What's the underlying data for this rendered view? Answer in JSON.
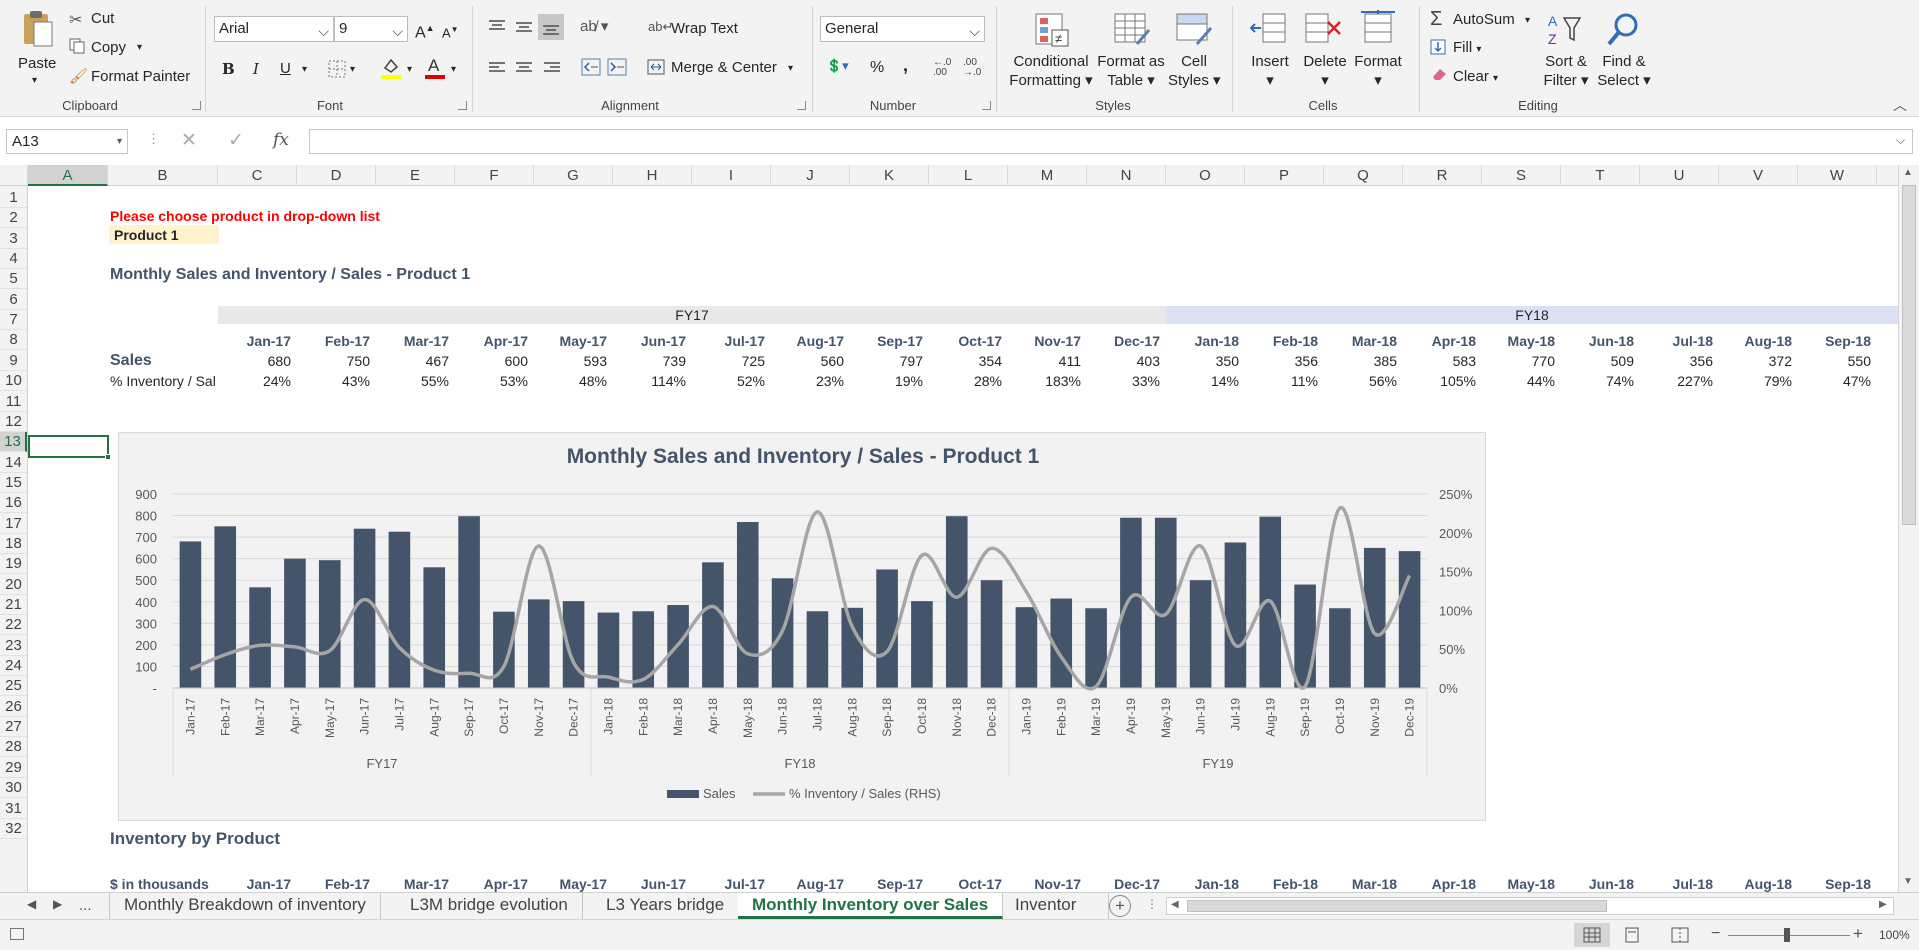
{
  "ribbon": {
    "clipboard": {
      "paste": "Paste",
      "cut": "Cut",
      "copy": "Copy",
      "format_painter": "Format Painter",
      "label": "Clipboard"
    },
    "font": {
      "name": "Arial",
      "size": "9",
      "label": "Font",
      "bold": "B",
      "italic": "I",
      "underline": "U"
    },
    "alignment": {
      "wrap_text": "Wrap Text",
      "merge_center": "Merge & Center",
      "label": "Alignment"
    },
    "number": {
      "format": "General",
      "percent": "%",
      "comma": ",",
      "label": "Number"
    },
    "styles": {
      "conditional": "Conditional",
      "conditional2": "Formatting",
      "format_as": "Format as",
      "format_as2": "Table",
      "cell": "Cell",
      "cell2": "Styles",
      "label": "Styles"
    },
    "cells": {
      "insert": "Insert",
      "delete": "Delete",
      "format": "Format",
      "label": "Cells"
    },
    "editing": {
      "autosum": "AutoSum",
      "fill": "Fill",
      "clear": "Clear",
      "sort": "Sort &",
      "sort2": "Filter",
      "find": "Find &",
      "find2": "Select",
      "label": "Editing"
    }
  },
  "formula_bar": {
    "name_box": "A13",
    "fx": "fx",
    "formula": ""
  },
  "columns": [
    "A",
    "B",
    "C",
    "D",
    "E",
    "F",
    "G",
    "H",
    "I",
    "J",
    "K",
    "L",
    "M",
    "N",
    "O",
    "P",
    "Q",
    "R",
    "S",
    "T",
    "U",
    "V",
    "W"
  ],
  "rows": [
    "1",
    "2",
    "3",
    "4",
    "5",
    "6",
    "7",
    "8",
    "9",
    "10",
    "11",
    "12",
    "13",
    "14",
    "15",
    "16",
    "17",
    "18",
    "19",
    "20",
    "21",
    "22",
    "23",
    "24",
    "25",
    "26",
    "27",
    "28",
    "29",
    "30",
    "31",
    "32"
  ],
  "sheet": {
    "instruction": "Please choose product in drop-down list",
    "product": "Product 1",
    "section_title": "Monthly Sales and Inventory / Sales -  Product 1",
    "fy17": "FY17",
    "fy18": "FY18",
    "months": [
      "Jan-17",
      "Feb-17",
      "Mar-17",
      "Apr-17",
      "May-17",
      "Jun-17",
      "Jul-17",
      "Aug-17",
      "Sep-17",
      "Oct-17",
      "Nov-17",
      "Dec-17",
      "Jan-18",
      "Feb-18",
      "Mar-18",
      "Apr-18",
      "May-18",
      "Jun-18",
      "Jul-18",
      "Aug-18",
      "Sep-18"
    ],
    "sales_label": "Sales",
    "sales": [
      "680",
      "750",
      "467",
      "600",
      "593",
      "739",
      "725",
      "560",
      "797",
      "354",
      "411",
      "403",
      "350",
      "356",
      "385",
      "583",
      "770",
      "509",
      "356",
      "372",
      "550"
    ],
    "inv_label": "% Inventory / Sal",
    "inv": [
      "24%",
      "43%",
      "55%",
      "53%",
      "48%",
      "114%",
      "52%",
      "23%",
      "19%",
      "28%",
      "183%",
      "33%",
      "14%",
      "11%",
      "56%",
      "105%",
      "44%",
      "74%",
      "227%",
      "79%",
      "47%"
    ],
    "inventory_title": "Inventory by  Product",
    "thousands_label": "$ in thousands"
  },
  "chart_data": {
    "type": "bar",
    "title": "Monthly Sales and Inventory / Sales -  Product 1",
    "categories": [
      "Jan-17",
      "Feb-17",
      "Mar-17",
      "Apr-17",
      "May-17",
      "Jun-17",
      "Jul-17",
      "Aug-17",
      "Sep-17",
      "Oct-17",
      "Nov-17",
      "Dec-17",
      "Jan-18",
      "Feb-18",
      "Mar-18",
      "Apr-18",
      "May-18",
      "Jun-18",
      "Jul-18",
      "Aug-18",
      "Sep-18",
      "Oct-18",
      "Nov-18",
      "Dec-18",
      "Jan-19",
      "Feb-19",
      "Mar-19",
      "Apr-19",
      "May-19",
      "Jun-19",
      "Jul-19",
      "Aug-19",
      "Sep-19",
      "Oct-19",
      "Nov-19",
      "Dec-19"
    ],
    "groups": [
      "FY17",
      "FY18",
      "FY19"
    ],
    "series": [
      {
        "name": "Sales",
        "type": "bar",
        "axis": "left",
        "color": "#44546a",
        "values": [
          680,
          750,
          467,
          600,
          593,
          739,
          725,
          560,
          797,
          354,
          411,
          403,
          350,
          356,
          385,
          583,
          770,
          509,
          356,
          372,
          550,
          403,
          797,
          500,
          375,
          415,
          370,
          790,
          790,
          500,
          675,
          795,
          480,
          370,
          650,
          635
        ]
      },
      {
        "name": "% Inventory / Sales (RHS)",
        "type": "line",
        "axis": "right",
        "color": "#a6a6a6",
        "values": [
          24,
          43,
          55,
          53,
          48,
          114,
          52,
          23,
          19,
          28,
          183,
          33,
          14,
          11,
          56,
          105,
          44,
          74,
          227,
          79,
          47,
          171,
          117,
          180,
          124,
          40,
          2,
          117,
          95,
          183,
          55,
          112,
          2,
          232,
          70,
          145
        ]
      }
    ],
    "ylim": [
      0,
      900
    ],
    "yticks": [
      "-",
      "100",
      "200",
      "300",
      "400",
      "500",
      "600",
      "700",
      "800",
      "900"
    ],
    "y2lim": [
      0,
      250
    ],
    "y2ticks": [
      "0%",
      "50%",
      "100%",
      "150%",
      "200%",
      "250%"
    ],
    "legend": "bottom"
  },
  "tabs": {
    "nav_more": "...",
    "items": [
      "Monthly Breakdown of inventory",
      "L3M bridge evolution",
      "L3 Years bridge",
      "Monthly Inventory over Sales",
      "Inventor ..."
    ],
    "active": 3
  },
  "status": {
    "zoom": "100%"
  }
}
